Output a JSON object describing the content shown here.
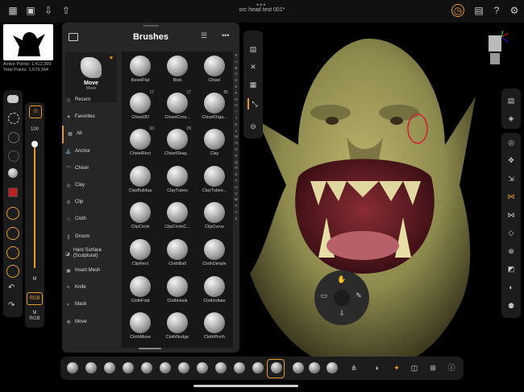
{
  "topbar": {
    "title": "orc head test 001*"
  },
  "stats": {
    "active": "Active Points: 1,412,369",
    "total": "Total Points: 1,679,364"
  },
  "sizebar": {
    "value": "100",
    "mode": "M",
    "rgb": "RGB",
    "m_rgb_1": "M",
    "m_rgb_2": "RGB"
  },
  "panel": {
    "title": "Brushes",
    "selected": {
      "name": "Move",
      "sub": "Move"
    },
    "categories": [
      "Recent",
      "Favorites",
      "All",
      "Anchor",
      "Chisel",
      "Clay",
      "Clip",
      "Cloth",
      "Groom",
      "Hard Surface (Sculptural)",
      "Insert Mesh",
      "Knife",
      "Mask",
      "Move"
    ],
    "brushes": [
      {
        "label": "BevelFlat",
        "count": ""
      },
      {
        "label": "Blob",
        "count": ""
      },
      {
        "label": "Chisel",
        "count": ""
      },
      {
        "label": "Chisel3D",
        "count": "17"
      },
      {
        "label": "ChiselCrea...",
        "count": "17"
      },
      {
        "label": "ChiselOrga...",
        "count": "85"
      },
      {
        "label": "ChiselRect",
        "count": "33"
      },
      {
        "label": "ChiselShap...",
        "count": "29"
      },
      {
        "label": "Clay",
        "count": ""
      },
      {
        "label": "ClayBuildup",
        "count": ""
      },
      {
        "label": "ClayTubes",
        "count": ""
      },
      {
        "label": "ClayTubes...",
        "count": ""
      },
      {
        "label": "ClipCircle",
        "count": ""
      },
      {
        "label": "ClipCircleC...",
        "count": ""
      },
      {
        "label": "ClipCurve",
        "count": ""
      },
      {
        "label": "ClipRect",
        "count": ""
      },
      {
        "label": "ClothBall",
        "count": ""
      },
      {
        "label": "ClothDimple",
        "count": ""
      },
      {
        "label": "ClothFold",
        "count": ""
      },
      {
        "label": "ClothHook",
        "count": ""
      },
      {
        "label": "ClothInflate",
        "count": ""
      },
      {
        "label": "ClothMove",
        "count": ""
      },
      {
        "label": "ClothNudge",
        "count": ""
      },
      {
        "label": "ClothPinch",
        "count": ""
      }
    ],
    "alphabet": [
      "#",
      "A",
      "B",
      "C",
      "D",
      "E",
      "F",
      "G",
      "H",
      "I",
      "J",
      "K",
      "L",
      "M",
      "N",
      "O",
      "P",
      "Q",
      "R",
      "S",
      "T",
      "U",
      "V",
      "W",
      "X",
      "Y",
      "Z"
    ]
  },
  "colors": {
    "accent": "#e89a28",
    "panel": "#262626"
  }
}
